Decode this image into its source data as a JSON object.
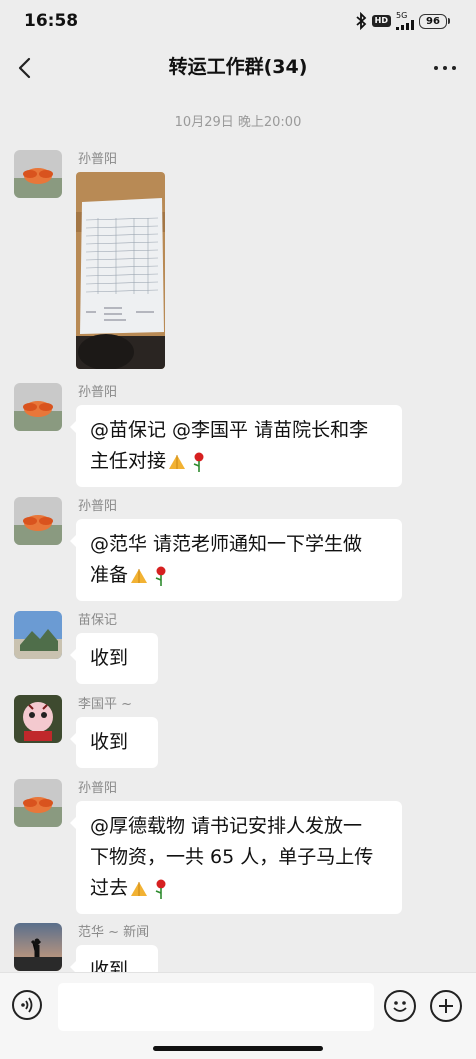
{
  "status_bar": {
    "time": "16:58",
    "hd_label": "HD",
    "network_label": "5G",
    "battery": "96",
    "icons": [
      "bluetooth-icon",
      "hd-icon",
      "signal-icon",
      "battery-icon"
    ]
  },
  "nav": {
    "title": "转运工作群(34)",
    "back_icon": "chevron-left-icon",
    "more_icon": "more-dots-icon"
  },
  "timestamp": "10月29日 晚上20:00",
  "messages": [
    {
      "sender": "孙普阳",
      "type": "image",
      "image": "photo of a paper form (table) on a desk"
    },
    {
      "sender": "孙普阳",
      "type": "text",
      "lines": [
        "@苗保记 @李国平  请苗院长和李",
        "主任对接"
      ],
      "trailing_emoji": [
        "pray-emoji",
        "rose-emoji"
      ]
    },
    {
      "sender": "孙普阳",
      "type": "text",
      "lines": [
        "@范华  请范老师通知一下学生做",
        "准备"
      ],
      "trailing_emoji": [
        "pray-emoji",
        "rose-emoji"
      ]
    },
    {
      "sender": "苗保记",
      "type": "text",
      "lines": [
        "收到"
      ]
    },
    {
      "sender": "李国平 ~",
      "type": "text",
      "lines": [
        "收到"
      ]
    },
    {
      "sender": "孙普阳",
      "type": "text",
      "lines": [
        "@厚德载物  请书记安排人发放一",
        "下物资，一共 65 人，单子马上传",
        "过去"
      ],
      "trailing_emoji": [
        "pray-emoji",
        "rose-emoji"
      ]
    },
    {
      "sender": "范华 ~ 新闻",
      "type": "text",
      "lines": [
        "收到"
      ]
    }
  ],
  "input_bar": {
    "voice_icon": "voice-icon",
    "emoji_icon": "emoji-icon",
    "plus_icon": "plus-icon",
    "placeholder": ""
  },
  "colors": {
    "background": "#ededed",
    "bubble": "#ffffff",
    "sender_text": "#8a8a8a"
  }
}
